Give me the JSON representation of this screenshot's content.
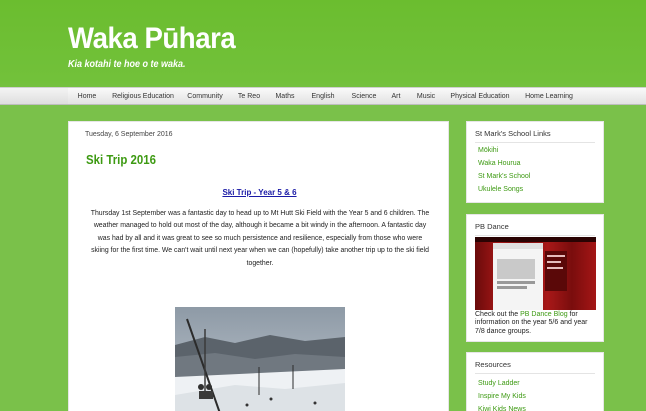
{
  "blog": {
    "title": "Waka Pūhara",
    "description": "Kia kotahi te hoe o te waka."
  },
  "nav": {
    "items": [
      {
        "label": "Home"
      },
      {
        "label": "Religious Education"
      },
      {
        "label": "Community"
      },
      {
        "label": "Te Reo"
      },
      {
        "label": "Maths"
      },
      {
        "label": "English"
      },
      {
        "label": "Science"
      },
      {
        "label": "Art"
      },
      {
        "label": "Music"
      },
      {
        "label": "Physical Education"
      },
      {
        "label": "Home Learning"
      }
    ]
  },
  "post": {
    "date": "Tuesday, 6 September 2016",
    "title": "Ski Trip 2016",
    "subtitle": "Ski Trip - Year 5 & 6",
    "body_lines": [
      "Thursday 1st September was a fantastic day to head up to Mt Hutt Ski Field with the Year 5 and 6 children.  The",
      "weather managed to hold out most of the day, although it became a bit windy in the afternoon.  A fantastic day",
      "was had by all and it was great to see so much persistence and resilience, especially from those who were",
      "skiing for the first time.   We can't wait until next year when we can (hopefully) take another trip up to the ski field",
      "together."
    ]
  },
  "sidebar": {
    "links_widget": {
      "title": "St Mark's School Links",
      "links": [
        {
          "label": "Mōkihi"
        },
        {
          "label": "Waka Hourua"
        },
        {
          "label": "St Mark's School"
        },
        {
          "label": "Ukulele Songs"
        }
      ]
    },
    "pb_widget": {
      "title": "PB Dance",
      "caption_pre": "Check out the ",
      "caption_link": "PB Dance Blog",
      "caption_post": " for information on the year 5/6 and year 7/8 dance groups."
    },
    "resources_widget": {
      "title": "Resources",
      "links": [
        {
          "label": "Study Ladder"
        },
        {
          "label": "Inspire My Kids"
        },
        {
          "label": "Kiwi Kids News"
        }
      ]
    }
  },
  "colors": {
    "background": "#7ac14a",
    "accent": "#3d9a12",
    "link_blue": "#1a1aa6"
  }
}
